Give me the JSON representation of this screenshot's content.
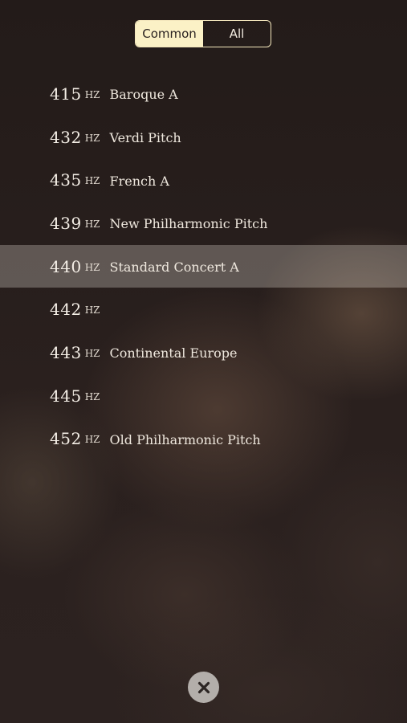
{
  "segmented": {
    "common_label": "Common",
    "all_label": "All",
    "selected": "Common"
  },
  "unit": "HZ",
  "pitches": [
    {
      "freq": "415",
      "name": "Baroque A"
    },
    {
      "freq": "432",
      "name": "Verdi Pitch"
    },
    {
      "freq": "435",
      "name": "French A"
    },
    {
      "freq": "439",
      "name": "New Philharmonic Pitch"
    },
    {
      "freq": "440",
      "name": "Standard Concert A",
      "selected": true
    },
    {
      "freq": "442",
      "name": ""
    },
    {
      "freq": "443",
      "name": "Continental Europe"
    },
    {
      "freq": "445",
      "name": ""
    },
    {
      "freq": "452",
      "name": "Old Philharmonic Pitch"
    }
  ],
  "colors": {
    "segment_active_bg": "#fbf1c6",
    "segment_border": "#f3e6bc",
    "selected_row_bg": "#e6ded4",
    "close_button_bg": "#b3aeaa",
    "background": "#231b19"
  },
  "icons": {
    "close": "close-x-icon"
  }
}
